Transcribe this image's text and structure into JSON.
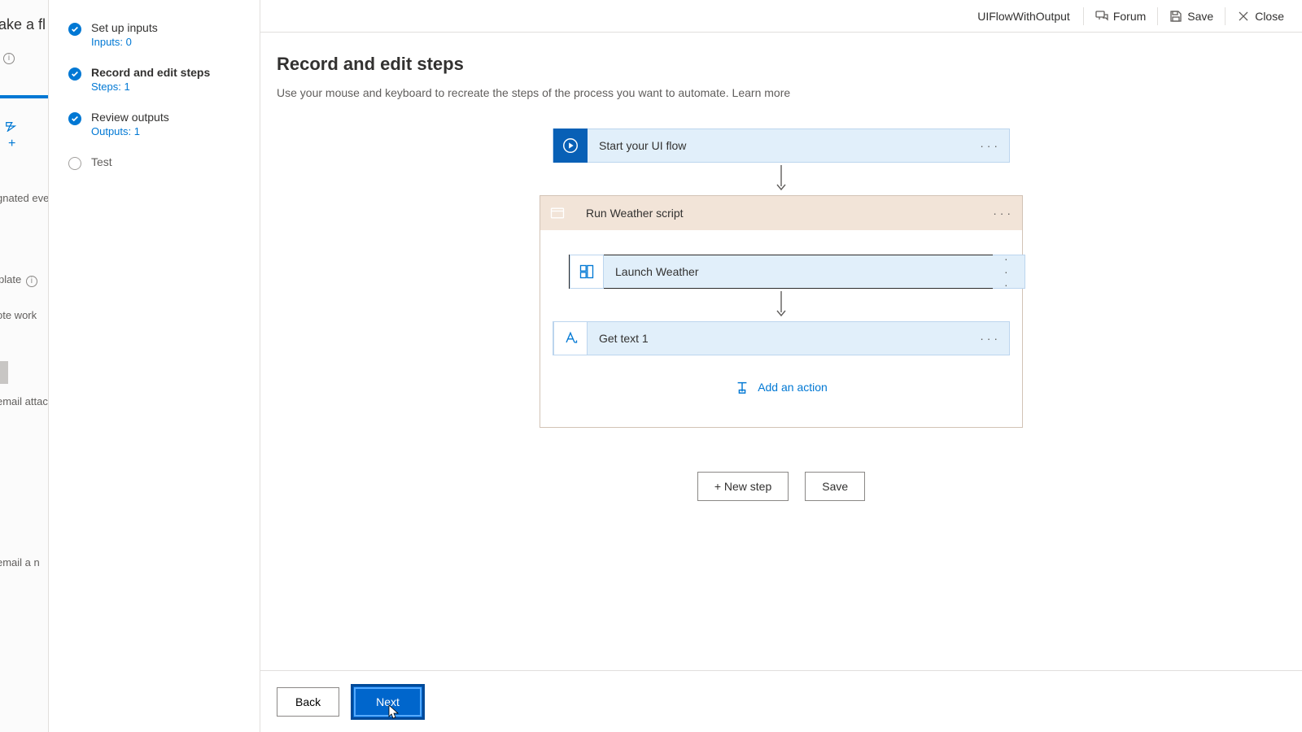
{
  "bgstrip": {
    "title_frag": "ake a fl",
    "frag_designated": "gnated even",
    "frag_template": "plate",
    "frag_remote": "ote work",
    "frag_email1": "email attac",
    "frag_email2": "email a n"
  },
  "steps": {
    "s1": {
      "title": "Set up inputs",
      "sub": "Inputs: 0"
    },
    "s2": {
      "title": "Record and edit steps",
      "sub": "Steps: 1"
    },
    "s3": {
      "title": "Review outputs",
      "sub": "Outputs: 1"
    },
    "s4": {
      "title": "Test"
    }
  },
  "topbar": {
    "flowname": "UIFlowWithOutput",
    "forum": "Forum",
    "save": "Save",
    "close": "Close"
  },
  "page": {
    "heading": "Record and edit steps",
    "desc": "Use your mouse and keyboard to recreate the steps of the process you want to automate.  ",
    "learn": "Learn more"
  },
  "flow": {
    "start": "Start your UI flow",
    "script_header": "Run Weather script",
    "launch": "Launch Weather",
    "gettext": "Get text 1",
    "add_action": "Add an action",
    "new_step": "+ New step",
    "save": "Save"
  },
  "footer": {
    "back": "Back",
    "next": "Next"
  }
}
